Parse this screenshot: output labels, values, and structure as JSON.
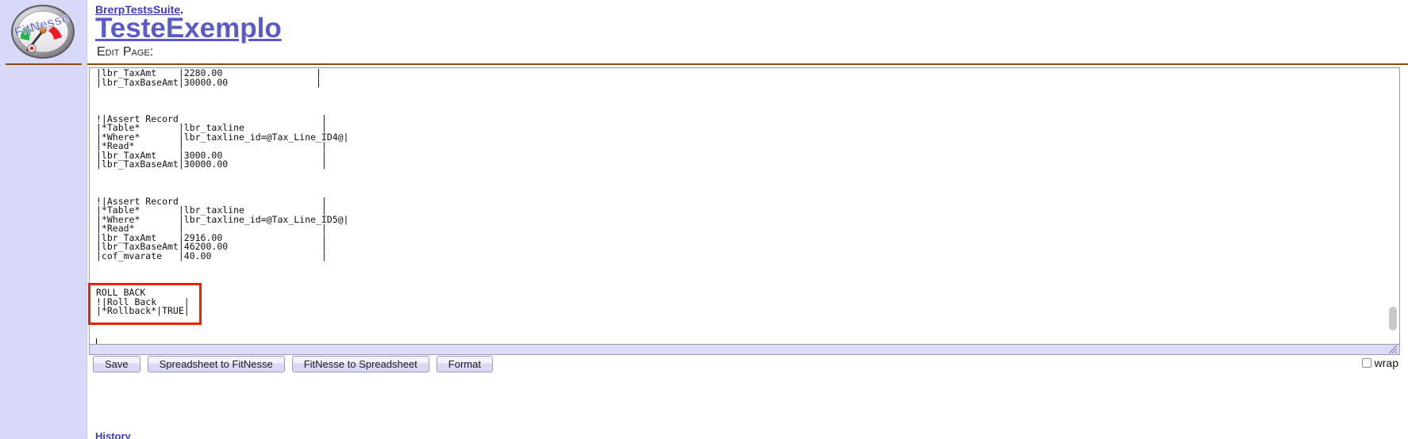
{
  "header": {
    "breadcrumb_link": "BrerpTestsSuite",
    "breadcrumb_separator": ".",
    "page_title": "TesteExemplo",
    "section_label": "Edit Page:"
  },
  "logo": {
    "brand_text": "FitNesse",
    "icon_name": "fitnesse-gauge-logo"
  },
  "editor": {
    "content": "|lbr_TaxAmt    |2280.00                 |\n|lbr_TaxBaseAmt|30000.00                |\n\n\n\n!|Assert Record                          |\n|*Table*       |lbr_taxline              |\n|*Where*       |lbr_taxline_id=@Tax_Line_ID4@|\n|*Read*        |                         |\n|lbr_TaxAmt    |3000.00                  |\n|lbr_TaxBaseAmt|30000.00                 |\n\n\n\n!|Assert Record                          |\n|*Table*       |lbr_taxline              |\n|*Where*       |lbr_taxline_id=@Tax_Line_ID5@|\n|*Read*        |                         |\n|lbr_TaxAmt    |2916.00                  |\n|lbr_TaxBaseAmt|46200.00                 |\n|cof_mvarate   |40.00                    |\n\n\n\nROLL BACK\n!|Roll Back     |\n|*Rollback*|TRUE|\n",
    "annotation_color": "#f02000"
  },
  "toolbar": {
    "save_label": "Save",
    "spreadsheet_to_fitnesse_label": "Spreadsheet to FitNesse",
    "fitnesse_to_spreadsheet_label": "FitNesse to Spreadsheet",
    "format_label": "Format"
  },
  "options": {
    "wrap_label": "wrap",
    "wrap_checked": false
  },
  "footer": {
    "partial_link": "History"
  }
}
